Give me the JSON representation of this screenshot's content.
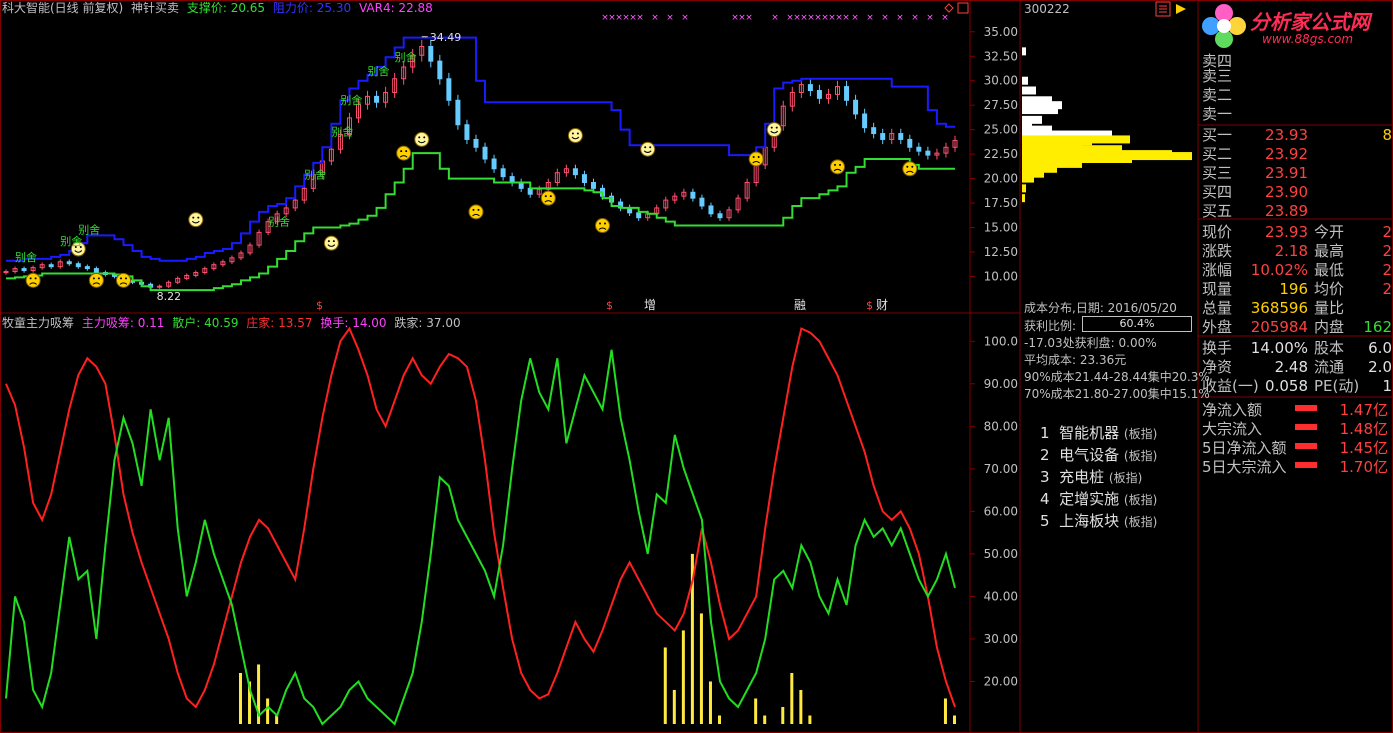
{
  "main_header": {
    "title": "科大智能(日线 前复权)",
    "indicator_name": "神针买卖",
    "support_label": "支撑价: 20.65",
    "resist_label": "阻力价: 25.30",
    "var4_label": "VAR4: 22.88"
  },
  "sub_header": {
    "name": "牧童主力吸筹",
    "main_absorb": "主力吸筹: 0.11",
    "retail": "散户: 40.59",
    "banker": "庄家: 13.57",
    "turnover": "换手: 14.00",
    "follow": "跌家: 37.00"
  },
  "stock_code": "300222",
  "logo": {
    "text": "分析家公式网",
    "url": "www.88gs.com"
  },
  "price_axis": [
    "35.00",
    "32.50",
    "30.00",
    "27.50",
    "25.00",
    "22.50",
    "20.00",
    "17.50",
    "15.00",
    "12.50",
    "10.00"
  ],
  "sub_axis": [
    "100.0",
    "90.00",
    "80.00",
    "70.00",
    "60.00",
    "50.00",
    "40.00",
    "30.00",
    "20.00"
  ],
  "price_annotations": {
    "high": "34.49",
    "low": "8.22"
  },
  "marker_labels": {
    "bie_she": "别舍",
    "event_s": "$",
    "event_zeng": "增",
    "event_rong": "融",
    "event_cai": "财",
    "event_s2": "$"
  },
  "orderbook": {
    "sells": [
      {
        "label": "卖四"
      },
      {
        "label": "卖三"
      },
      {
        "label": "卖二"
      },
      {
        "label": "卖一"
      }
    ],
    "buys": [
      {
        "label": "买一",
        "price": "23.93",
        "vol": "8"
      },
      {
        "label": "买二",
        "price": "23.92",
        "vol": ""
      },
      {
        "label": "买三",
        "price": "23.91",
        "vol": ""
      },
      {
        "label": "买四",
        "price": "23.90",
        "vol": ""
      },
      {
        "label": "买五",
        "price": "23.89",
        "vol": ""
      }
    ]
  },
  "quote": [
    {
      "l1": "现价",
      "v1": "23.93",
      "l2": "今开",
      "v2": "2"
    },
    {
      "l1": "涨跌",
      "v1": "2.18",
      "l2": "最高",
      "v2": "2"
    },
    {
      "l1": "涨幅",
      "v1": "10.02%",
      "l2": "最低",
      "v2": "2"
    },
    {
      "l1": "现量",
      "v1": "196",
      "l2": "均价",
      "v2": "2"
    },
    {
      "l1": "总量",
      "v1": "368596",
      "l2": "量比",
      "v2": ""
    },
    {
      "l1": "外盘",
      "v1": "205984",
      "l2": "内盘",
      "v2": "162"
    },
    {
      "l1": "换手",
      "v1": "14.00%",
      "l2": "股本",
      "v2": "6.0"
    },
    {
      "l1": "净资",
      "v1": "2.48",
      "l2": "流通",
      "v2": "2.0"
    },
    {
      "l1": "收益(一)",
      "v1": "0.058",
      "l2": "PE(动)",
      "v2": "1"
    }
  ],
  "cost": {
    "title": "成本分布,日期: 2016/05/20",
    "profit_label": "获利比例:",
    "profit_value": "60.4%",
    "line1": "-17.03处获利盘: 0.00%",
    "line2": "平均成本: 23.36元",
    "line3": "90%成本21.44-28.44集中20.3%",
    "line4": "70%成本21.80-27.00集中15.1%"
  },
  "sectors": [
    {
      "num": "1",
      "name": "智能机器",
      "tag": "(板指)"
    },
    {
      "num": "2",
      "name": "电气设备",
      "tag": "(板指)"
    },
    {
      "num": "3",
      "name": "充电桩",
      "tag": "(板指)"
    },
    {
      "num": "4",
      "name": "定增实施",
      "tag": "(板指)"
    },
    {
      "num": "5",
      "name": "上海板块",
      "tag": "(板指)"
    }
  ],
  "flows": [
    {
      "label": "净流入额",
      "value": "1.47亿"
    },
    {
      "label": "大宗流入",
      "value": "1.48亿"
    },
    {
      "label": "5日净流入额",
      "value": "1.45亿"
    },
    {
      "label": "5日大宗流入",
      "value": "1.70亿"
    }
  ],
  "chart_data": {
    "type": "line",
    "price_series": {
      "close": [
        10.5,
        10.8,
        10.6,
        10.9,
        11.2,
        11.0,
        11.5,
        11.3,
        11.0,
        10.8,
        10.4,
        10.2,
        10.0,
        9.6,
        9.4,
        9.2,
        8.9,
        9.0,
        9.4,
        9.8,
        10.1,
        10.4,
        10.8,
        11.2,
        11.5,
        11.9,
        12.4,
        13.2,
        14.5,
        15.6,
        16.4,
        17.0,
        17.8,
        19.0,
        20.4,
        21.8,
        23.0,
        24.5,
        26.2,
        27.6,
        28.4,
        27.8,
        28.8,
        30.2,
        31.4,
        32.6,
        33.5,
        32.0,
        30.2,
        28.0,
        25.5,
        24.0,
        23.2,
        22.0,
        21.0,
        20.2,
        19.6,
        19.0,
        18.4,
        18.9,
        19.6,
        20.6,
        21.0,
        20.4,
        19.6,
        19.0,
        18.2,
        17.6,
        17.0,
        16.5,
        16.0,
        16.4,
        17.0,
        17.8,
        18.2,
        18.6,
        18.0,
        17.2,
        16.4,
        16.0,
        16.8,
        18.0,
        19.6,
        21.4,
        23.2,
        25.4,
        27.4,
        28.8,
        29.6,
        29.0,
        28.2,
        28.6,
        29.4,
        28.0,
        26.6,
        25.2,
        24.6,
        24.0,
        24.6,
        24.0,
        23.2,
        22.8,
        22.4,
        22.6,
        23.2,
        23.9
      ],
      "support": [
        9.8,
        9.9,
        10.0,
        10.1,
        10.3,
        10.3,
        10.3,
        10.3,
        10.3,
        10.3,
        10.3,
        10.3,
        10.2,
        10.0,
        9.6,
        9.0,
        8.6,
        8.6,
        8.6,
        8.6,
        8.6,
        8.6,
        8.6,
        8.8,
        9.0,
        9.2,
        9.6,
        9.9,
        10.3,
        11.0,
        11.8,
        12.6,
        13.6,
        14.4,
        15.0,
        15.0,
        15.0,
        15.2,
        15.4,
        15.8,
        16.2,
        17.0,
        18.4,
        19.6,
        21.0,
        22.6,
        22.6,
        22.6,
        21.0,
        20.0,
        20.0,
        20.0,
        20.0,
        20.0,
        19.6,
        19.6,
        19.6,
        19.6,
        19.0,
        19.0,
        19.0,
        19.0,
        19.0,
        19.0,
        18.8,
        18.6,
        18.0,
        17.2,
        17.0,
        17.0,
        16.6,
        16.4,
        16.0,
        15.6,
        15.2,
        15.2,
        15.2,
        15.2,
        15.2,
        15.2,
        15.2,
        15.2,
        15.2,
        15.2,
        15.2,
        15.2,
        16.0,
        17.2,
        18.0,
        18.0,
        18.4,
        18.8,
        19.2,
        20.6,
        21.2,
        22.0,
        22.0,
        22.0,
        22.0,
        22.0,
        21.4,
        21.0,
        21.0,
        21.0,
        21.0,
        21.0
      ],
      "resist": [
        11.6,
        11.6,
        11.8,
        11.8,
        11.8,
        12.0,
        12.2,
        12.6,
        13.4,
        14.2,
        14.2,
        14.2,
        13.8,
        13.2,
        12.6,
        12.0,
        11.8,
        11.6,
        11.6,
        11.6,
        11.8,
        12.0,
        12.4,
        12.6,
        12.8,
        13.4,
        14.4,
        15.6,
        16.6,
        17.2,
        17.4,
        18.0,
        19.2,
        20.4,
        21.6,
        23.2,
        25.6,
        28.0,
        29.2,
        30.0,
        30.6,
        31.4,
        32.4,
        33.4,
        34.4,
        34.4,
        34.4,
        34.4,
        34.4,
        34.4,
        34.4,
        34.4,
        30.0,
        27.8,
        27.8,
        27.8,
        27.8,
        27.8,
        27.8,
        27.8,
        27.8,
        27.8,
        27.8,
        27.8,
        27.8,
        27.8,
        27.8,
        27.0,
        25.0,
        23.4,
        23.4,
        23.4,
        23.4,
        23.4,
        23.4,
        23.4,
        23.4,
        23.4,
        23.4,
        23.4,
        22.4,
        22.4,
        22.4,
        23.2,
        25.6,
        29.2,
        29.8,
        30.0,
        30.2,
        30.2,
        30.2,
        30.2,
        30.2,
        30.2,
        30.2,
        30.2,
        30.2,
        30.2,
        29.4,
        29.4,
        29.4,
        29.4,
        27.0,
        25.6,
        25.3,
        25.3
      ],
      "ylim": [
        8.0,
        36.0
      ]
    },
    "sub_series": {
      "red": [
        90,
        85,
        75,
        62,
        58,
        64,
        74,
        84,
        92,
        96,
        94,
        90,
        78,
        64,
        55,
        48,
        42,
        36,
        30,
        22,
        16,
        14,
        18,
        24,
        32,
        40,
        48,
        54,
        58,
        56,
        52,
        48,
        44,
        56,
        70,
        82,
        92,
        100,
        103,
        98,
        92,
        84,
        80,
        86,
        92,
        96,
        92,
        90,
        94,
        97,
        96,
        94,
        86,
        72,
        55,
        42,
        30,
        22,
        18,
        16,
        17,
        22,
        28,
        34,
        30,
        27,
        32,
        38,
        44,
        48,
        44,
        40,
        36,
        34,
        32,
        36,
        44,
        56,
        48,
        38,
        30,
        32,
        36,
        40,
        56,
        70,
        82,
        94,
        103,
        102,
        100,
        96,
        92,
        86,
        80,
        74,
        66,
        60,
        58,
        60,
        56,
        50,
        40,
        28,
        20,
        14
      ],
      "green": [
        16,
        40,
        34,
        18,
        14,
        22,
        38,
        54,
        44,
        46,
        30,
        52,
        72,
        82,
        76,
        66,
        84,
        72,
        82,
        56,
        40,
        48,
        58,
        50,
        44,
        38,
        28,
        18,
        12,
        14,
        12,
        18,
        22,
        16,
        14,
        10,
        12,
        14,
        18,
        20,
        16,
        14,
        12,
        10,
        16,
        22,
        34,
        50,
        68,
        66,
        58,
        54,
        50,
        46,
        40,
        52,
        70,
        86,
        96,
        88,
        84,
        96,
        76,
        84,
        92,
        88,
        84,
        98,
        82,
        72,
        60,
        50,
        64,
        62,
        78,
        70,
        64,
        58,
        34,
        20,
        16,
        14,
        18,
        22,
        30,
        44,
        46,
        42,
        52,
        48,
        40,
        36,
        44,
        38,
        52,
        58,
        54,
        56,
        52,
        56,
        50,
        44,
        40,
        44,
        50,
        42
      ],
      "volume": [
        0,
        0,
        0,
        0,
        0,
        0,
        0,
        0,
        0,
        0,
        0,
        0,
        0,
        0,
        0,
        0,
        0,
        0,
        0,
        0,
        0,
        0,
        0,
        0,
        0,
        0,
        12,
        10,
        14,
        6,
        2,
        0,
        0,
        0,
        0,
        0,
        0,
        0,
        0,
        0,
        0,
        0,
        0,
        0,
        0,
        0,
        0,
        0,
        0,
        0,
        0,
        0,
        0,
        0,
        0,
        0,
        0,
        0,
        0,
        0,
        0,
        0,
        0,
        0,
        0,
        0,
        0,
        0,
        0,
        0,
        0,
        0,
        0,
        18,
        8,
        22,
        40,
        26,
        10,
        2,
        0,
        0,
        0,
        6,
        2,
        0,
        4,
        12,
        8,
        2,
        0,
        0,
        0,
        0,
        0,
        0,
        0,
        0,
        0,
        0,
        0,
        0,
        0,
        0,
        6,
        2
      ],
      "ylim": [
        10,
        105
      ]
    },
    "colors": {
      "support": "#33dd33",
      "resist": "#1a1aff",
      "red_line": "#ff2020",
      "green_line": "#22dd22",
      "volume": "#ffe840",
      "grid": "#800000",
      "candle_up": "#ff5070",
      "candle_dn": "#66ccff"
    }
  }
}
